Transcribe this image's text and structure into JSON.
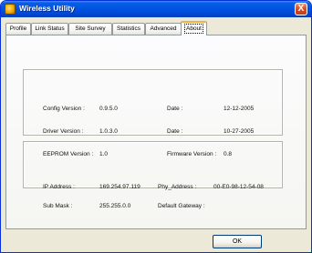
{
  "window": {
    "title": "Wireless Utility",
    "close_label": "X"
  },
  "tabs": [
    {
      "label": "Profile"
    },
    {
      "label": "Link Status"
    },
    {
      "label": "Site Survey"
    },
    {
      "label": "Statistics"
    },
    {
      "label": "Advanced"
    },
    {
      "label": "About",
      "selected": true
    }
  ],
  "versions": {
    "config_version_label": "Config Version :",
    "config_version_value": "0.9.5.0",
    "config_date_label": "Date :",
    "config_date_value": "12-12-2005",
    "driver_version_label": "Driver Version :",
    "driver_version_value": "1.0.3.0",
    "driver_date_label": "Date :",
    "driver_date_value": "10-27-2005",
    "eeprom_version_label": "EEPROM Version :",
    "eeprom_version_value": "1.0",
    "firmware_version_label": "Firmware Version :",
    "firmware_version_value": "0.8"
  },
  "network": {
    "ip_label": "IP Address :",
    "ip_value": "169.254.97.119",
    "phy_label": "Phy_Address :",
    "phy_value": "00-E0-98-12-54-08",
    "mask_label": "Sub Mask :",
    "mask_value": "255.255.0.0",
    "gateway_label": "Default Gateway :",
    "gateway_value": ""
  },
  "footer": {
    "ok_label": "OK"
  },
  "colors": {
    "titlebar": "#0054e3",
    "window_bg": "#ece9d8",
    "active_tab_accent": "#f4b143",
    "close_button": "#d4502c"
  }
}
